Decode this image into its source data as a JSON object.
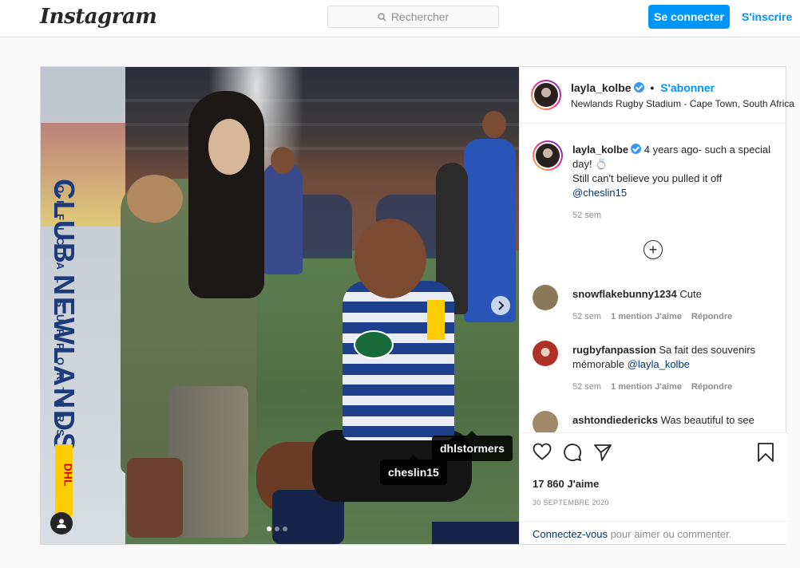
{
  "nav": {
    "logo": "Instagram",
    "search_placeholder": "Rechercher",
    "login_label": "Se connecter",
    "signup_label": "S'inscrire"
  },
  "post": {
    "author": "layla_kolbe",
    "follow_label": "S'abonner",
    "location": "Newlands Rugby Stadium - Cape Town, South Africa",
    "media": {
      "banner_title": "CLUB NEWLANDS",
      "banner_subtitle": "OFFICIAL SUPPORTERS CLUB",
      "banner_sponsor": "DHL",
      "tags": [
        "dhlstormers",
        "cheslin15"
      ],
      "slide_count": 3,
      "active_slide": 1
    },
    "caption": {
      "author": "layla_kolbe",
      "line1": "4 years ago- such a special day! 💍",
      "line2": "Still can't believe you pulled it off",
      "mention": "@cheslin15",
      "time": "52 sem"
    },
    "comments": [
      {
        "user": "snowflakebunny1234",
        "text": "Cute",
        "mention": "",
        "time": "52 sem",
        "likes": "1 mention J'aime",
        "reply": "Répondre",
        "avatar_color": "#8a7a5a"
      },
      {
        "user": "rugbyfanpassion",
        "text": "Sa fait des souvenirs mémorable",
        "mention": "@layla_kolbe",
        "time": "52 sem",
        "likes": "1 mention J'aime",
        "reply": "Répondre",
        "avatar_color": "#b03028"
      },
      {
        "user": "ashtondiedericks",
        "text": "Was beautiful to see",
        "mention": "",
        "time": "",
        "likes": "",
        "reply": "",
        "avatar_color": "#a08a6a"
      }
    ],
    "likes": "17 860 J'aime",
    "date": "30 SEPTEMBRE 2020",
    "login_prompt_link": "Connectez-vous",
    "login_prompt_rest": " pour aimer ou commenter."
  },
  "colors": {
    "accent": "#0095f6",
    "border": "#dbdbdb",
    "muted": "#8e8e8e"
  },
  "icons": [
    "search-icon",
    "verified-badge-icon",
    "chevron-right-icon",
    "user-tag-icon",
    "add-circle-icon",
    "heart-icon",
    "comment-icon",
    "share-icon",
    "bookmark-icon"
  ]
}
